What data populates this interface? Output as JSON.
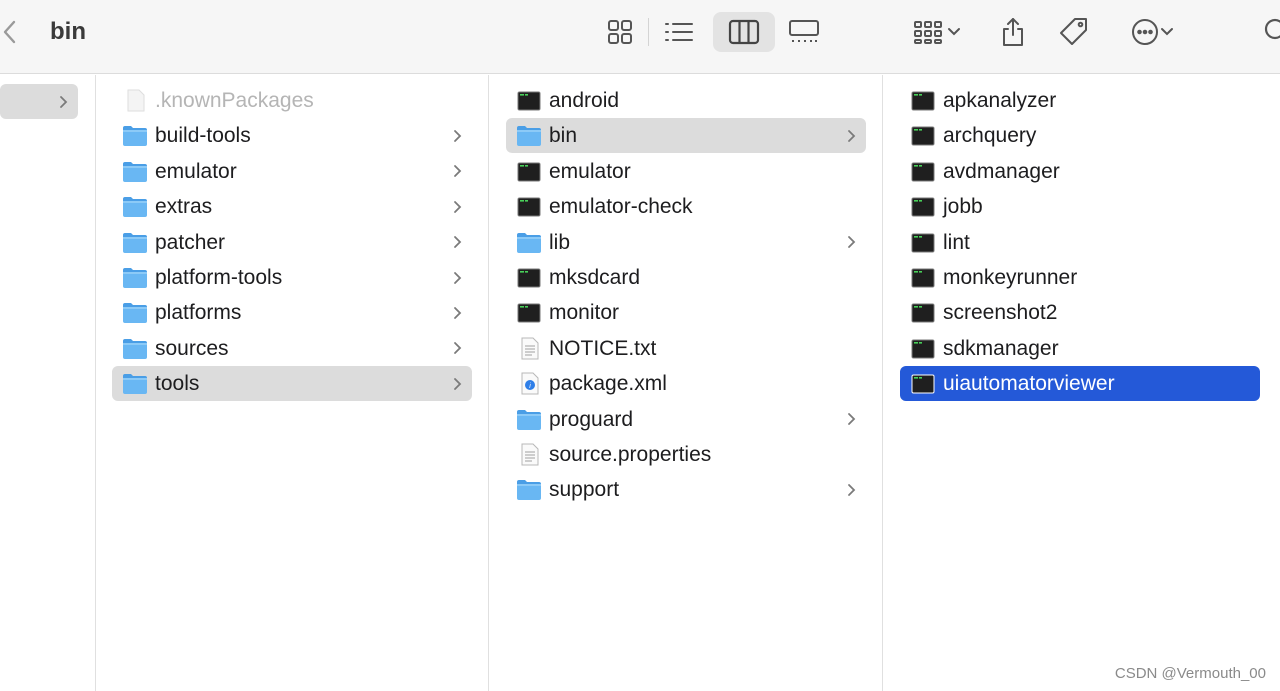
{
  "toolbar": {
    "title": "bin",
    "back_icon": "chevron-left-icon",
    "view_buttons": [
      "icon-view-icon",
      "list-view-icon",
      "column-view-icon",
      "gallery-view-icon"
    ],
    "actions": [
      "group-icon",
      "share-icon",
      "tag-icon",
      "more-icon",
      "search-icon"
    ]
  },
  "columns": {
    "col1": [
      {
        "name": ".knownPackages",
        "kind": "file-blank",
        "folder": false
      },
      {
        "name": "build-tools",
        "kind": "folder",
        "folder": true
      },
      {
        "name": "emulator",
        "kind": "folder",
        "folder": true
      },
      {
        "name": "extras",
        "kind": "folder",
        "folder": true
      },
      {
        "name": "patcher",
        "kind": "folder",
        "folder": true
      },
      {
        "name": "platform-tools",
        "kind": "folder",
        "folder": true
      },
      {
        "name": "platforms",
        "kind": "folder",
        "folder": true
      },
      {
        "name": "sources",
        "kind": "folder",
        "folder": true
      },
      {
        "name": "tools",
        "kind": "folder",
        "folder": true
      }
    ],
    "col2": [
      {
        "name": "android",
        "kind": "exec",
        "folder": false
      },
      {
        "name": "bin",
        "kind": "folder",
        "folder": true
      },
      {
        "name": "emulator",
        "kind": "exec",
        "folder": false
      },
      {
        "name": "emulator-check",
        "kind": "exec",
        "folder": false
      },
      {
        "name": "lib",
        "kind": "folder",
        "folder": true
      },
      {
        "name": "mksdcard",
        "kind": "exec",
        "folder": false
      },
      {
        "name": "monitor",
        "kind": "exec",
        "folder": false
      },
      {
        "name": "NOTICE.txt",
        "kind": "text",
        "folder": false
      },
      {
        "name": "package.xml",
        "kind": "xml",
        "folder": false
      },
      {
        "name": "proguard",
        "kind": "folder",
        "folder": true
      },
      {
        "name": "source.properties",
        "kind": "doc",
        "folder": false
      },
      {
        "name": "support",
        "kind": "folder",
        "folder": true
      }
    ],
    "col3": [
      {
        "name": "apkanalyzer",
        "kind": "exec",
        "folder": false
      },
      {
        "name": "archquery",
        "kind": "exec",
        "folder": false
      },
      {
        "name": "avdmanager",
        "kind": "exec",
        "folder": false
      },
      {
        "name": "jobb",
        "kind": "exec",
        "folder": false
      },
      {
        "name": "lint",
        "kind": "exec",
        "folder": false
      },
      {
        "name": "monkeyrunner",
        "kind": "exec",
        "folder": false
      },
      {
        "name": "screenshot2",
        "kind": "exec",
        "folder": false
      },
      {
        "name": "sdkmanager",
        "kind": "exec",
        "folder": false
      },
      {
        "name": "uiautomatorviewer",
        "kind": "exec",
        "folder": false
      }
    ]
  },
  "selection": {
    "col1": "tools",
    "col2": "bin",
    "col3": "uiautomatorviewer"
  },
  "watermark": "CSDN @Vermouth_00",
  "colors": {
    "accent": "#2459d8",
    "folder": "#5aaef0",
    "selection_gray": "#dcdcdc"
  }
}
